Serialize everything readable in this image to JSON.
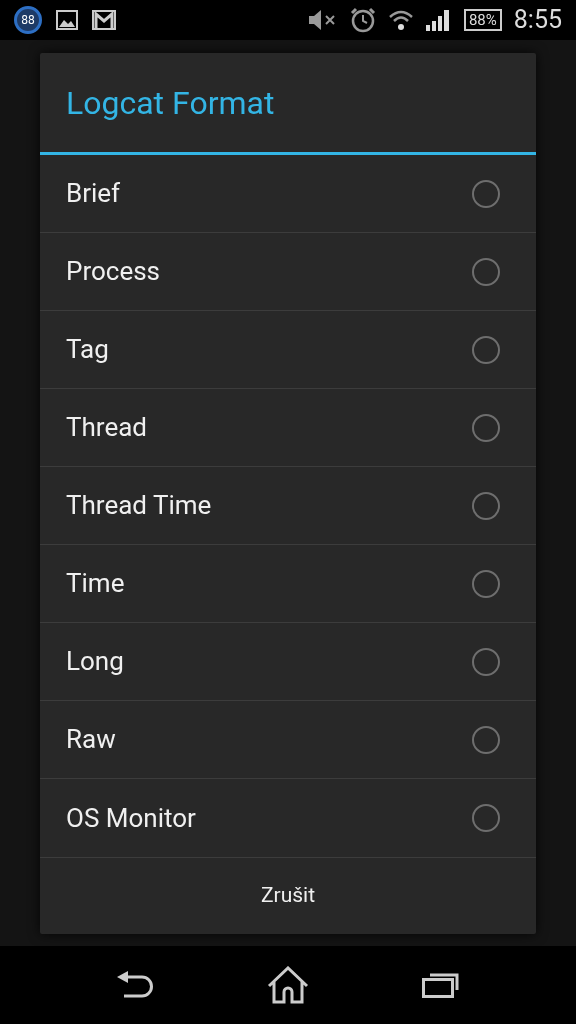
{
  "status_bar": {
    "notification_badge": "88",
    "battery": "88%",
    "time": "8:55"
  },
  "dialog": {
    "title": "Logcat Format",
    "options": [
      {
        "label": "Brief",
        "selected": false
      },
      {
        "label": "Process",
        "selected": false
      },
      {
        "label": "Tag",
        "selected": false
      },
      {
        "label": "Thread",
        "selected": false
      },
      {
        "label": "Thread Time",
        "selected": false
      },
      {
        "label": "Time",
        "selected": false
      },
      {
        "label": "Long",
        "selected": false
      },
      {
        "label": "Raw",
        "selected": false
      },
      {
        "label": "OS Monitor",
        "selected": false
      }
    ],
    "cancel_button": "Zrušit"
  }
}
